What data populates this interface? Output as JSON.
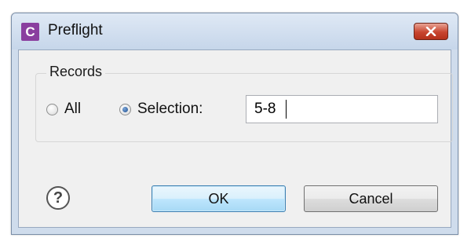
{
  "window": {
    "title": "Preflight",
    "app_icon_letter": "C",
    "app_icon_color": "#8a3f9f",
    "close_icon": "close-icon"
  },
  "records_group": {
    "label": "Records",
    "options": [
      {
        "label": "All",
        "selected": false
      },
      {
        "label": "Selection:",
        "selected": true
      }
    ],
    "selection_value": "5-8"
  },
  "footer": {
    "help_icon": "help-icon",
    "help_symbol": "?",
    "ok_label": "OK",
    "cancel_label": "Cancel"
  }
}
